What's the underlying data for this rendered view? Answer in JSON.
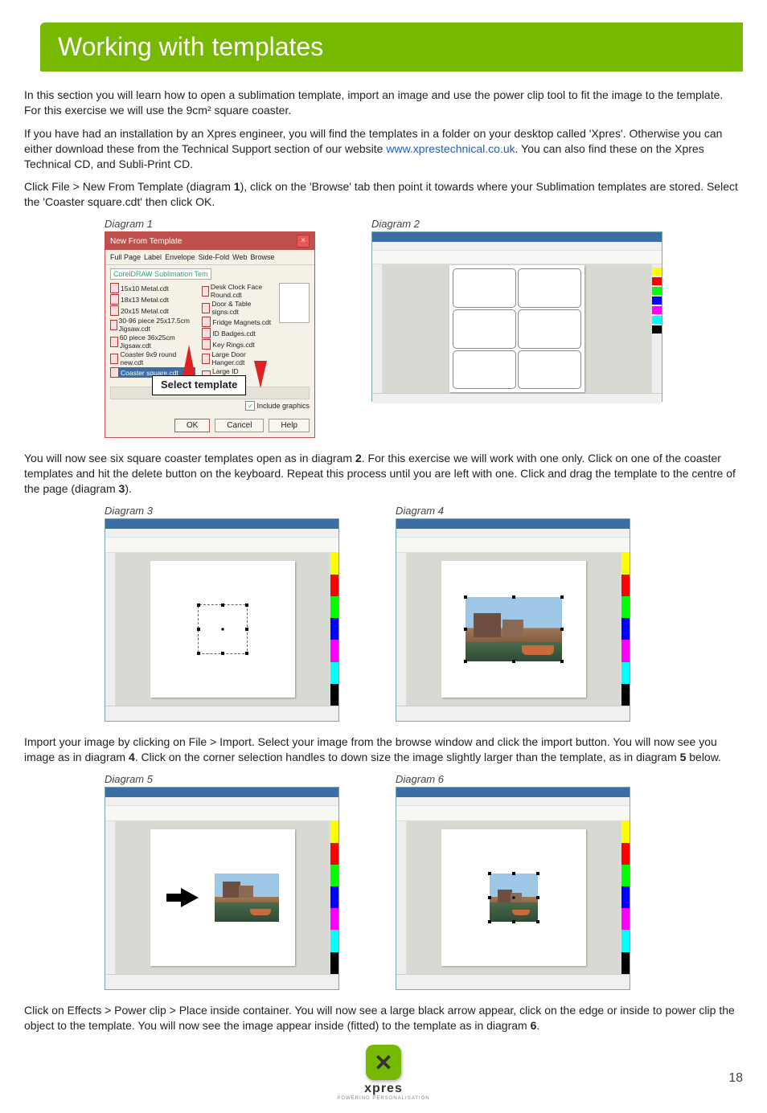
{
  "header": {
    "title": "Working with templates"
  },
  "paragraphs": {
    "p1": "In this section you will learn how to open a sublimation template, import an image and use the power clip tool to fit the image to the template. For this exercise we will use the 9cm² square coaster.",
    "p2a": "If you have had an installation by an Xpres engineer, you will find the templates in a folder on your desktop called 'Xpres'. Otherwise you can either download these from the Technical Support section of our website ",
    "p2_link": "www.xprestechnical.co.uk",
    "p2b": ". You can also find these on the Xpres Technical CD, and Subli-Print CD.",
    "p3a": "Click File > New From Template (diagram ",
    "p3_num": "1",
    "p3b": "), click on the 'Browse' tab then point it towards where your Sublimation templates are stored. Select the 'Coaster square.cdt' then click OK.",
    "p4a": "You will now see six square coaster templates open as in diagram ",
    "p4_num": "2",
    "p4b": ". For this exercise we will work with one only. Click on one of the coaster templates and hit the delete button on the keyboard. Repeat this process until you are left with one. Click and drag the template to the centre of the page (diagram ",
    "p4_num2": "3",
    "p4c": ").",
    "p5a": "Import your image by clicking on File > Import. Select your image from the browse window and click the import button. You will now see you image as in diagram ",
    "p5_num": "4",
    "p5b": ". Click on the corner selection handles to down size the image slightly larger than the template, as in diagram ",
    "p5_num2": "5",
    "p5c": " below.",
    "p6a": "Click on Effects > Power clip > Place inside container. You will now see a large black arrow appear, click on the edge or inside to power clip the object to the template. You will now see the image appear inside (fitted) to the template as in diagram ",
    "p6_num": "6",
    "p6b": "."
  },
  "captions": {
    "d1": "Diagram 1",
    "d2": "Diagram 2",
    "d3": "Diagram 3",
    "d4": "Diagram 4",
    "d5": "Diagram 5",
    "d6": "Diagram 6"
  },
  "dialog1": {
    "title": "New From Template",
    "tabs": [
      "Full Page",
      "Label",
      "Envelope",
      "Side-Fold",
      "Web",
      "Browse"
    ],
    "folder": "CorelDRAW Sublimation Tem",
    "files_col1": [
      "15x10 Metal.cdt",
      "18x13 Metal.cdt",
      "20x15 Metal.cdt",
      "30-96 piece 25x17.5cm Jigsaw.cdt",
      "60 piece 36x25cm Jigsaw.cdt",
      "Coaster 9x9 round new.cdt",
      "Coaster square.cdt"
    ],
    "files_col2": [
      "Desk Clock Face Round.cdt",
      "Door & Table signs.cdt",
      "Fridge Magnets.cdt",
      "ID Badges.cdt",
      "Key Rings.cdt",
      "Large Door Hanger.cdt",
      "Large ID Badges.cdt"
    ],
    "include_graphics": "Include graphics",
    "ok": "OK",
    "cancel": "Cancel",
    "help": "Help",
    "callout": "Select template"
  },
  "footer": {
    "brand": "xpres",
    "tagline": "POWERING PERSONALISATION",
    "page": "18"
  }
}
